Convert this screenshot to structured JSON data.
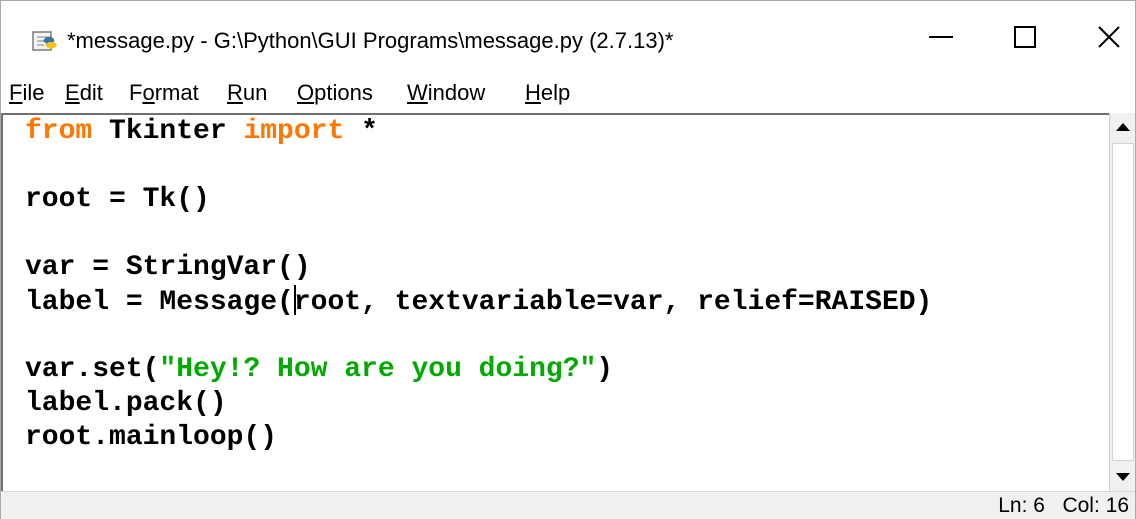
{
  "window": {
    "title": "*message.py - G:\\Python\\GUI Programs\\message.py (2.7.13)*",
    "controls": {
      "minimize": "minimize",
      "maximize": "maximize",
      "close": "close"
    }
  },
  "menu": {
    "items": [
      {
        "label": "File",
        "underline": "F",
        "rest": "ile"
      },
      {
        "label": "Edit",
        "underline": "E",
        "rest": "dit"
      },
      {
        "label": "Format",
        "pre": "F",
        "underline": "o",
        "rest": "rmat"
      },
      {
        "label": "Run",
        "underline": "R",
        "rest": "un"
      },
      {
        "label": "Options",
        "underline": "O",
        "rest": "ptions"
      },
      {
        "label": "Window",
        "underline": "W",
        "rest": "indow"
      },
      {
        "label": "Help",
        "underline": "H",
        "rest": "elp"
      }
    ]
  },
  "editor": {
    "lines": [
      {
        "kw1": "from",
        "t1": " Tkinter ",
        "kw2": "import",
        "t2": " *"
      },
      {
        "text": ""
      },
      {
        "text": "root = Tk()"
      },
      {
        "text": ""
      },
      {
        "text": "var = StringVar()"
      },
      {
        "pre": "label = Message(",
        "post": "root, textvariable=var, relief=RAISED)"
      },
      {
        "text": ""
      },
      {
        "pre": "var.set(",
        "str": "\"Hey!? How are you doing?\"",
        "post": ")"
      },
      {
        "text": "label.pack()"
      },
      {
        "text": "root.mainloop()"
      }
    ],
    "colors": {
      "keyword": "#ff7700",
      "string": "#00aa00",
      "default": "#000000"
    }
  },
  "status": {
    "text": "Ln: 6   Col: 16"
  }
}
